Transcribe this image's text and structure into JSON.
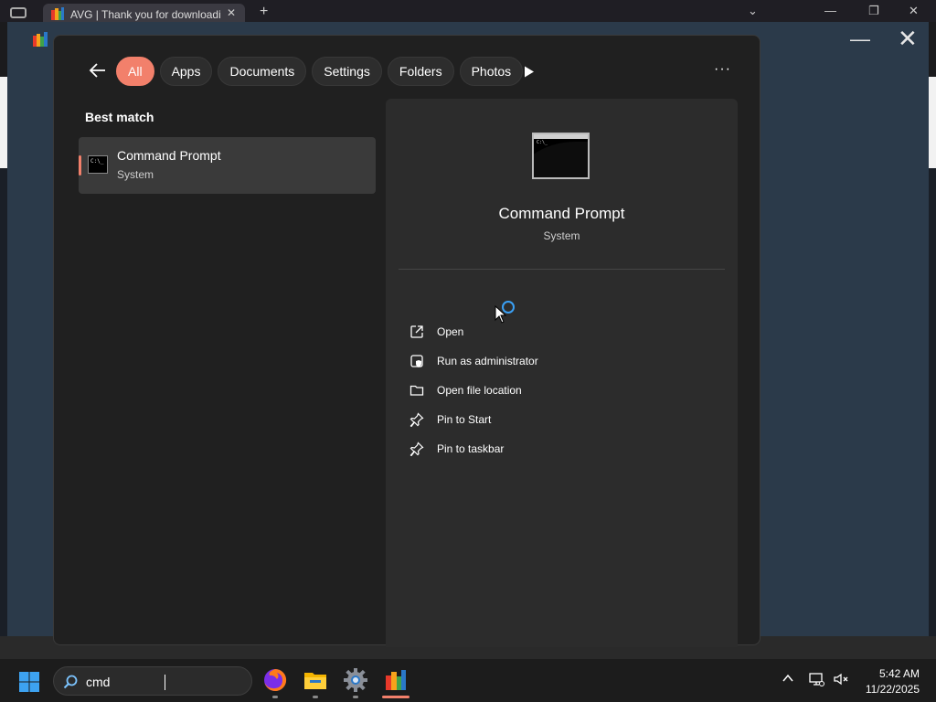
{
  "browser": {
    "tab_title": "AVG | Thank you for downloadi",
    "tab_close": "✕",
    "new_tab": "+",
    "minimize": "—",
    "restore": "❐",
    "close": "✕"
  },
  "background_window": {
    "minimize": "—",
    "close": "✕"
  },
  "search": {
    "filters": [
      {
        "label": "All",
        "active": true
      },
      {
        "label": "Apps",
        "active": false
      },
      {
        "label": "Documents",
        "active": false
      },
      {
        "label": "Settings",
        "active": false
      },
      {
        "label": "Folders",
        "active": false
      },
      {
        "label": "Photos",
        "active": false
      }
    ],
    "more": "···",
    "best_match_heading": "Best match",
    "best_match": {
      "title": "Command Prompt",
      "subtitle": "System",
      "icon_text": "C:\\_"
    },
    "detail": {
      "title": "Command Prompt",
      "subtitle": "System",
      "actions": [
        {
          "label": "Open",
          "icon": "open-external-icon"
        },
        {
          "label": "Run as administrator",
          "icon": "shield-admin-icon"
        },
        {
          "label": "Open file location",
          "icon": "folder-icon"
        },
        {
          "label": "Pin to Start",
          "icon": "pin-icon"
        },
        {
          "label": "Pin to taskbar",
          "icon": "pin-icon"
        }
      ]
    }
  },
  "taskbar": {
    "search_value": "cmd",
    "apps": [
      {
        "name": "Firefox",
        "icon": "firefox-icon",
        "active": false
      },
      {
        "name": "File Explorer",
        "icon": "file-explorer-icon",
        "active": false
      },
      {
        "name": "Settings",
        "icon": "settings-gear-icon",
        "active": false
      },
      {
        "name": "AVG",
        "icon": "avg-icon",
        "active": true
      }
    ],
    "time": "5:42 AM",
    "date": "11/22/2025"
  },
  "colors": {
    "accent": "#f2806b",
    "panel": "#202020",
    "detail_pane": "#2c2c2c",
    "busy": "#3aa0f5"
  }
}
